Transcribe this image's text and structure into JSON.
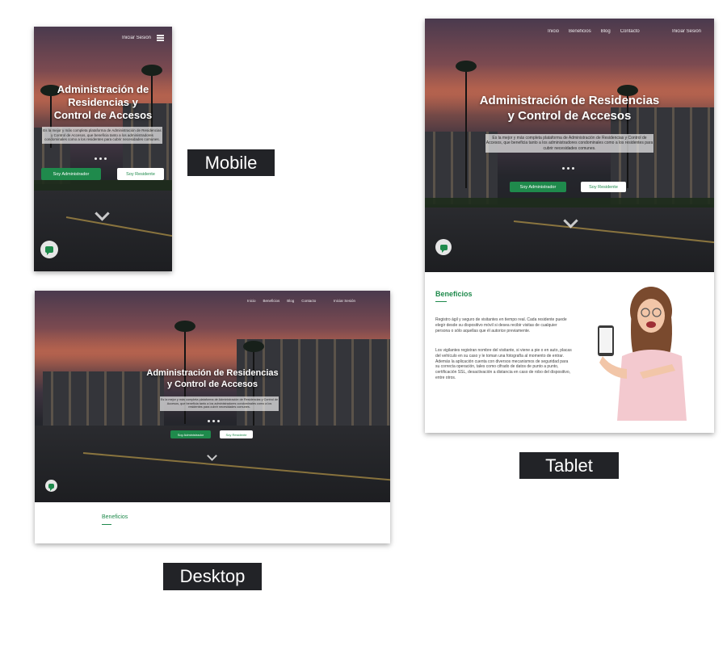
{
  "nav": {
    "items": [
      "Inicio",
      "Beneficios",
      "Blog",
      "Contacto"
    ],
    "login": "Iniciar Sesión"
  },
  "hero": {
    "title_full": "Administración de Residencias y Control de Accesos",
    "title_mobile_lines": [
      "Administración de",
      "Residencias y",
      "Control de Accesos"
    ],
    "title_wide_lines": [
      "Administración de Residencias",
      "y Control de Accesos"
    ],
    "description": "Es la mejor y más completa plataforma de Administración de Residencias y Control de Accesos, que beneficia tanto a los administradores condominales como a los residentes para cubrir necesidades comunes.",
    "btn_admin": "Soy Administrador",
    "btn_resident": "Soy Residente"
  },
  "benefits": {
    "title": "Beneficios",
    "paragraph1": "Registro ágil y seguro de visitantes en tiempo real. Cada residente puede elegir desde su dispositivo móvil si desea recibir visitas de cualquier persona o sólo aquellas que él autorice previamente.",
    "paragraph2": "Los vigilantes registran nombre del visitante, si viene a pie o en auto, placas del vehículo en su caso y le toman una fotografía al momento de entrar. Además la aplicación cuenta con diversos mecanismos de seguridad para su correcta operación, tales como cifrado de datos de punto a punto, certificación SSL, desactivación a distancia en caso de robo del dispositivo, entre otros."
  },
  "labels": {
    "mobile": "Mobile",
    "tablet": "Tablet",
    "desktop": "Desktop"
  },
  "colors": {
    "brand_green": "#1f8a4c",
    "label_bg": "#222327",
    "hero_dark": "#1a1b1e"
  },
  "icons": {
    "menu": "hamburger-menu-icon",
    "scroll": "chevron-down-icon",
    "chat": "chat-bubble-icon"
  }
}
